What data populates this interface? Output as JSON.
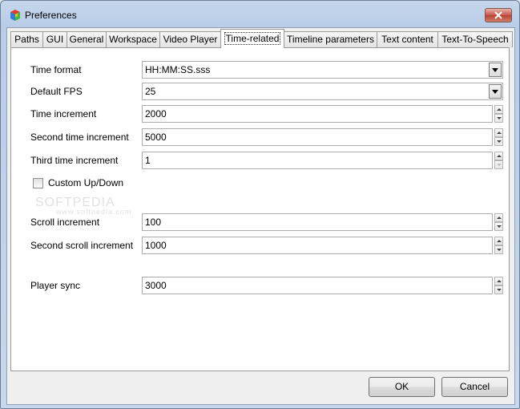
{
  "window": {
    "title": "Preferences"
  },
  "tabs": [
    {
      "label": "Paths"
    },
    {
      "label": "GUI"
    },
    {
      "label": "General"
    },
    {
      "label": "Workspace"
    },
    {
      "label": "Video Player"
    },
    {
      "label": "Time-related",
      "active": true
    },
    {
      "label": "Timeline parameters"
    },
    {
      "label": "Text content"
    },
    {
      "label": "Text-To-Speech"
    }
  ],
  "fields": {
    "time_format": {
      "label": "Time format",
      "value": "HH:MM:SS.sss"
    },
    "default_fps": {
      "label": "Default FPS",
      "value": "25"
    },
    "time_increment": {
      "label": "Time increment",
      "value": "2000"
    },
    "second_time_increment": {
      "label": "Second time increment",
      "value": "5000"
    },
    "third_time_increment": {
      "label": "Third time increment",
      "value": "1"
    },
    "custom_updown": {
      "label": "Custom Up/Down",
      "checked": false
    },
    "scroll_increment": {
      "label": "Scroll increment",
      "value": "100"
    },
    "second_scroll_increment": {
      "label": "Second scroll increment",
      "value": "1000"
    },
    "player_sync": {
      "label": "Player sync",
      "value": "3000"
    }
  },
  "buttons": {
    "ok": "OK",
    "cancel": "Cancel"
  },
  "watermark": {
    "text": "SOFTPEDIA",
    "sub": "www.softpedia.com"
  },
  "icons": {
    "app": "multicolor-cube-icon",
    "close": "close-x-icon"
  },
  "colors": {
    "close_button": "#c9574a",
    "titlebar": "#b9cde6"
  }
}
